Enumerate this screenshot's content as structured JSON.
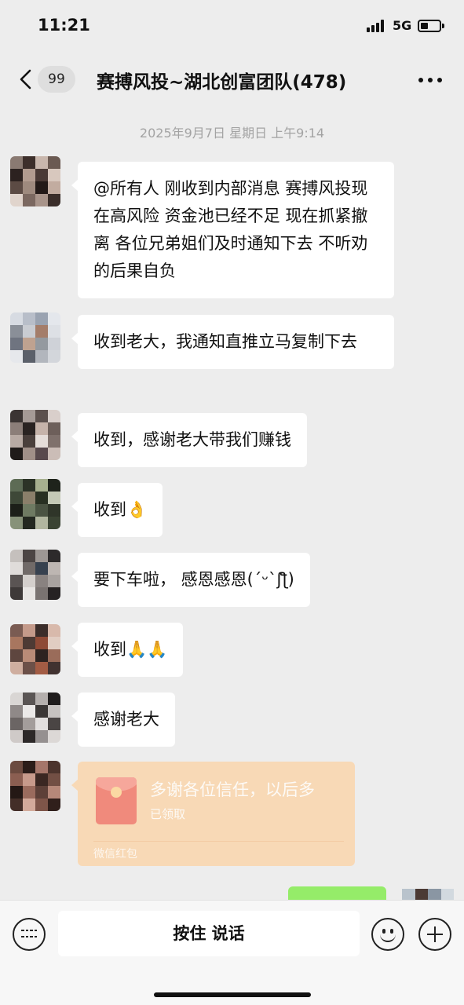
{
  "status_bar": {
    "time": "11:21",
    "network": "5G"
  },
  "header": {
    "unread_count": "99",
    "title": "赛搏风投~湖北创富团队(478)"
  },
  "date_stamp": "2025年9月7日 星期日 上午9:14",
  "messages": [
    {
      "text": "@所有人 刚收到内部消息 赛搏风投现在高风险 资金池已经不足 现在抓紧撤离 各位兄弟姐们及时通知下去 不听劝的后果自负"
    },
    {
      "text": "收到老大，我通知直推立马复制下去"
    },
    {
      "text": "收到，感谢老大带我们赚钱"
    },
    {
      "text": "收到👌"
    },
    {
      "text": "要下车啦， 感恩感恩(ˊᵕˋʃƪ)"
    },
    {
      "text": "收到🙏🙏"
    },
    {
      "text": "感谢老大"
    }
  ],
  "red_packet": {
    "message": "多谢各位信任，以后多",
    "status": "已领取",
    "source": "微信红包"
  },
  "input_bar": {
    "hold_to_talk_label": "按住 说话"
  },
  "colors": {
    "background": "#ededed",
    "bubble": "#ffffff",
    "red_packet": "#f8d9b6",
    "outgoing_bubble": "#95ec69"
  },
  "icons": [
    "back-icon",
    "more-icon",
    "keyboard-icon",
    "emoji-icon",
    "add-icon",
    "red-packet-icon"
  ]
}
